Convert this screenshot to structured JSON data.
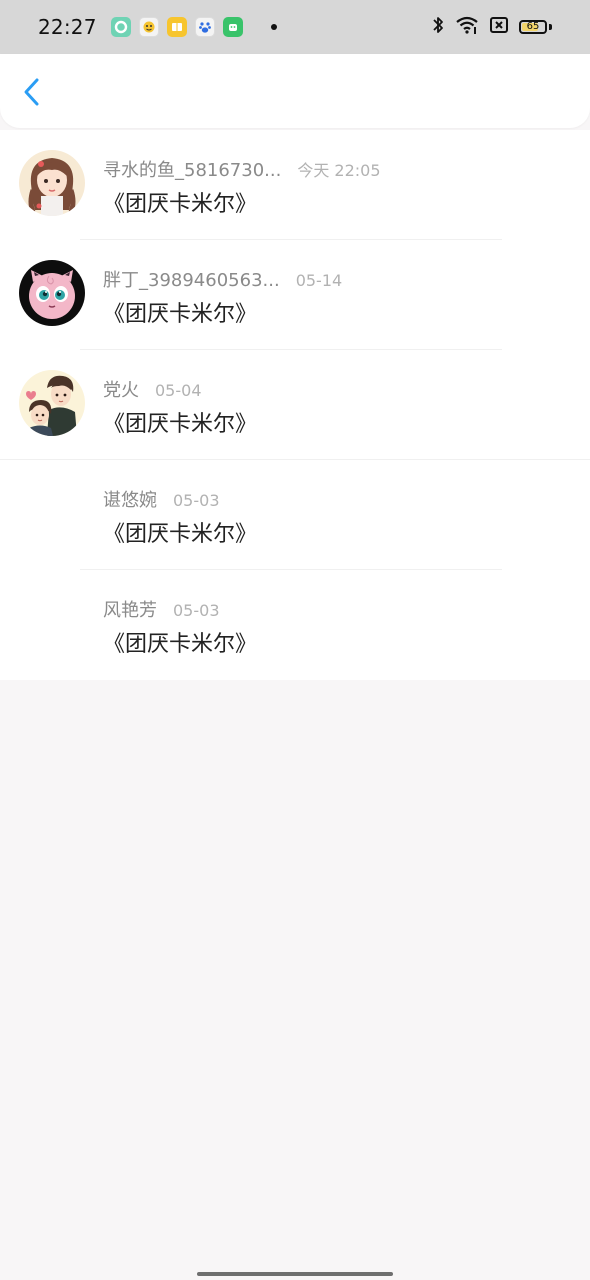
{
  "status_bar": {
    "time": "22:27",
    "battery": "65",
    "colors": {
      "background": "#d7d7d7",
      "battery_fill": "#f2d46a"
    },
    "icons": [
      "app-icon-green-circle",
      "app-icon-face",
      "app-icon-yellow-book",
      "app-icon-baidu",
      "app-icon-green-android",
      "notification-dot",
      "bluetooth-icon",
      "wifi-icon",
      "sim-off-icon",
      "battery-icon"
    ]
  },
  "header": {
    "back_icon": "chevron-left-icon",
    "accent": "#2a9df4"
  },
  "list": {
    "items": [
      {
        "name": "寻水的鱼_5816730...",
        "date": "今天 22:05",
        "content": "《团厌卡米尔》",
        "avatar": "girl-avatar"
      },
      {
        "name": "胖丁_3989460563...",
        "date": "05-14",
        "content": "《团厌卡米尔》",
        "avatar": "jigglypuff-avatar"
      },
      {
        "name": "党火",
        "date": "05-04",
        "content": "《团厌卡米尔》",
        "avatar": "couple-avatar"
      },
      {
        "name": "谌悠婉",
        "date": "05-03",
        "content": "《团厌卡米尔》",
        "avatar": ""
      },
      {
        "name": "风艳芳",
        "date": "05-03",
        "content": "《团厌卡米尔》",
        "avatar": ""
      }
    ]
  }
}
